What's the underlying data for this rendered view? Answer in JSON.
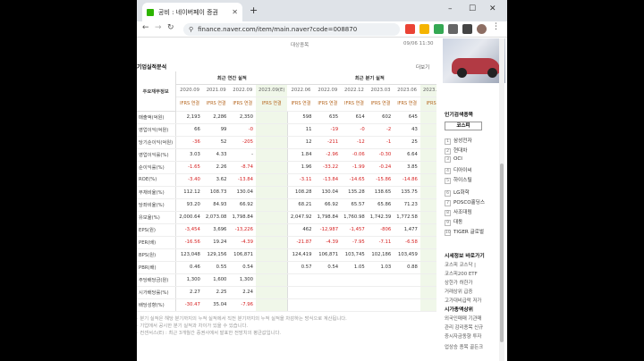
{
  "browser": {
    "tab_title": "공비 : 네이버페이 증권",
    "url": "finance.naver.com/item/main.naver?code=008870"
  },
  "page": {
    "top_left_meta": "대상종목",
    "top_right_meta": "09/06 11:30",
    "section_title": "기업실적분석",
    "more_label": "더보기",
    "group_annual": "최근 연간 실적",
    "group_quarter": "최근 분기 실적",
    "row_header_label": "주요재무정보",
    "periods": [
      "2020.09",
      "2021.09",
      "2022.09",
      "2023.09(E)",
      "2022.06",
      "2022.09",
      "2022.12",
      "2023.03",
      "2023.06",
      "2023.09(E)"
    ],
    "basis": [
      "IFRS 연결",
      "IFRS 연결",
      "IFRS 연결",
      "IFRS 연결",
      "IFRS 연결",
      "IFRS 연결",
      "IFRS 연결",
      "IFRS 연결",
      "IFRS 연결",
      "IFRS 연결"
    ],
    "rows": [
      {
        "label": "매출액(억원)",
        "v": [
          "2,193",
          "2,286",
          "2,350",
          "",
          "598",
          "635",
          "614",
          "602",
          "645",
          ""
        ]
      },
      {
        "label": "영업이익(억원)",
        "v": [
          "66",
          "99",
          "-0",
          "",
          "11",
          "-19",
          "-0",
          "-2",
          "43",
          ""
        ]
      },
      {
        "label": "당기순이익(억원)",
        "v": [
          "-36",
          "52",
          "-205",
          "",
          "12",
          "-211",
          "-12",
          "-1",
          "25",
          ""
        ]
      },
      {
        "label": "영업이익률(%)",
        "v": [
          "3.03",
          "4.33",
          "-",
          "",
          "1.84",
          "-2.96",
          "-0.06",
          "-0.30",
          "6.64",
          ""
        ]
      },
      {
        "label": "순이익률(%)",
        "v": [
          "-1.65",
          "2.26",
          "-8.74",
          "",
          "1.96",
          "-33.22",
          "-1.99",
          "-0.24",
          "3.85",
          ""
        ]
      },
      {
        "label": "ROE(%)",
        "v": [
          "-3.40",
          "3.62",
          "-13.84",
          "",
          "-3.11",
          "-13.84",
          "-14.65",
          "-15.86",
          "-14.86",
          ""
        ]
      },
      {
        "label": "부채비율(%)",
        "v": [
          "112.12",
          "108.73",
          "130.04",
          "",
          "108.28",
          "130.04",
          "135.28",
          "138.65",
          "135.75",
          ""
        ]
      },
      {
        "label": "당좌비율(%)",
        "v": [
          "93.20",
          "84.93",
          "66.92",
          "",
          "68.21",
          "66.92",
          "65.57",
          "65.86",
          "71.23",
          ""
        ]
      },
      {
        "label": "유보율(%)",
        "v": [
          "2,000.64",
          "2,073.08",
          "1,798.84",
          "",
          "2,047.92",
          "1,798.84",
          "1,760.98",
          "1,742.39",
          "1,772.58",
          ""
        ]
      },
      {
        "label": "EPS(원)",
        "v": [
          "-3,454",
          "3,696",
          "-13,226",
          "",
          "462",
          "-12,987",
          "-1,457",
          "-806",
          "1,477",
          ""
        ]
      },
      {
        "label": "PER(배)",
        "v": [
          "-16.56",
          "19.24",
          "-4.39",
          "",
          "-21.87",
          "-4.39",
          "-7.95",
          "-7.11",
          "-6.58",
          ""
        ]
      },
      {
        "label": "BPS(원)",
        "v": [
          "123,048",
          "129,156",
          "106,871",
          "",
          "124,419",
          "106,871",
          "103,745",
          "102,186",
          "103,459",
          ""
        ]
      },
      {
        "label": "PBR(배)",
        "v": [
          "0.46",
          "0.55",
          "0.54",
          "",
          "0.57",
          "0.54",
          "1.05",
          "1.03",
          "0.88",
          ""
        ]
      },
      {
        "label": "주당배당금(원)",
        "v": [
          "1,300",
          "1,600",
          "1,300",
          "",
          "",
          "",
          "",
          "",
          "",
          ""
        ]
      },
      {
        "label": "시가배당률(%)",
        "v": [
          "2.27",
          "2.25",
          "2.24",
          "",
          "",
          "",
          "",
          "",
          "",
          ""
        ]
      },
      {
        "label": "배당성향(%)",
        "v": [
          "-30.47",
          "35.04",
          "-7.96",
          "",
          "",
          "",
          "",
          "",
          "",
          ""
        ]
      }
    ],
    "notes": [
      "분기 실적은 해당 분기까지의 누적 실적에서 직전 분기까지의 누적 실적을 차감하는 방식으로 계산됩니다.",
      "기업에서 공시한 분기 실적과 차이가 있을 수 있습니다.",
      "컨센서스(E) : 최근 3개월간 증권사에서 발표한 전망치의 평균값입니다."
    ]
  },
  "sidebar": {
    "popular_title": "인기검색종목",
    "popular_tab": "코스피",
    "popular_items": [
      "삼성전자",
      "현대차",
      "OCI",
      "디아이씨",
      "하이스틸",
      "LG화학",
      "POSCO홀딩스",
      "사조대림",
      "대동",
      "TIGER 글로벌"
    ],
    "market_title": "시세정보 바로가기",
    "market_lines": [
      "코스피 코스닥 | ",
      "코스피200 ETF",
      "상한가 하한가",
      "거래상위 급증",
      "고가대비급락 저가"
    ],
    "sise_title": "시가총액상위",
    "sise_lines": [
      "외국인매매 기관매",
      "관리 감리종목 신규",
      "증시자금동향 투자"
    ],
    "bottom_line": "업상승 종목 골든크"
  }
}
